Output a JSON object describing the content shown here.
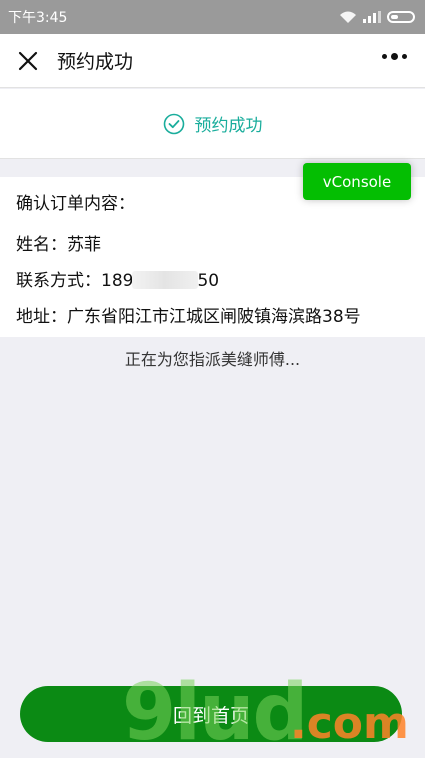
{
  "status_bar": {
    "time": "下午3:45"
  },
  "nav": {
    "title": "预约成功"
  },
  "success": {
    "text": "预约成功"
  },
  "order": {
    "heading": "确认订单内容：",
    "name_label": "姓名：",
    "name_value": "苏菲",
    "phone_label": "联系方式：",
    "phone_start": "189",
    "phone_end": "50",
    "address_label": "地址：",
    "address_value": "广东省阳江市江城区闸陂镇海滨路38号"
  },
  "vconsole": {
    "label": "vConsole"
  },
  "dispatch_text": "正在为您指派美缝师傅...",
  "home_button": {
    "label": "回到首页"
  },
  "watermark": {
    "brand": "9lud",
    "suffix": ".com"
  },
  "colors": {
    "accent_teal": "#1aad9c",
    "button_green": "#0b8a14",
    "vconsole_green": "#04be02",
    "background": "#efeff4"
  }
}
